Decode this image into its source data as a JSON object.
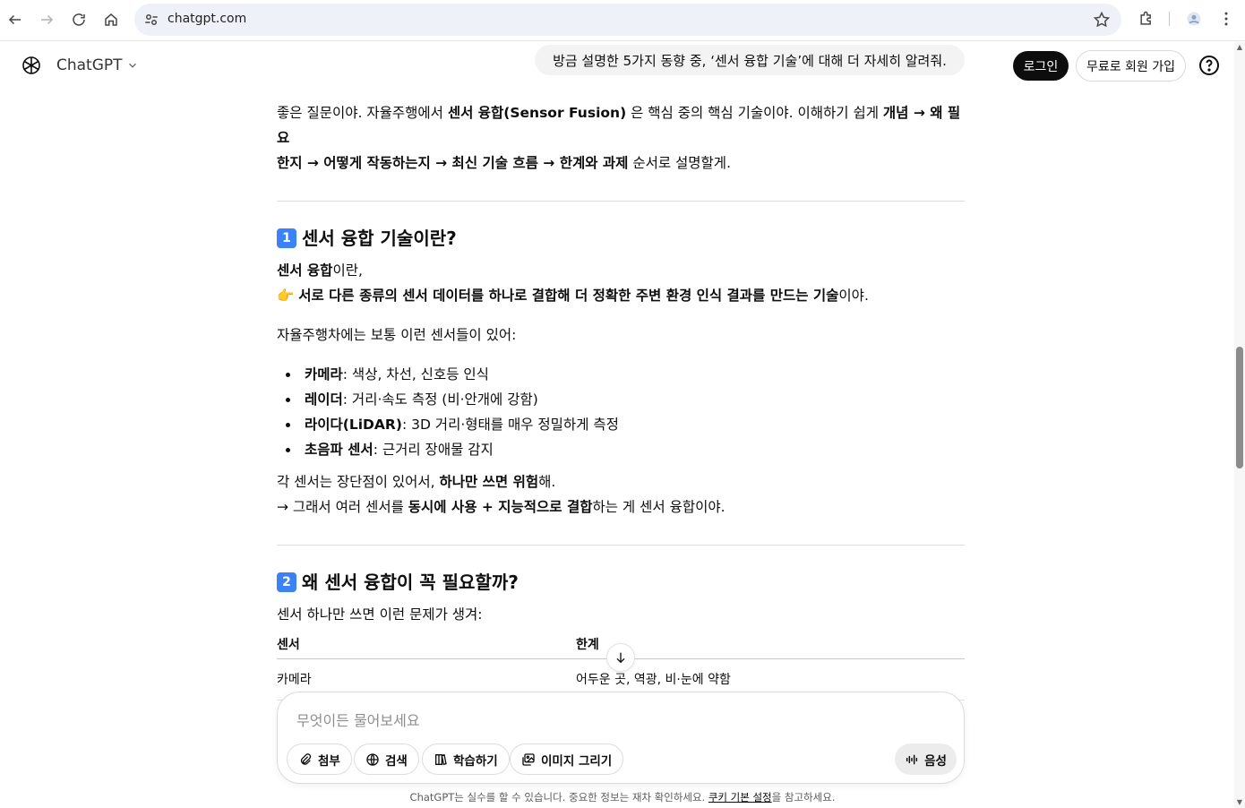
{
  "browser": {
    "url": "chatgpt.com"
  },
  "header": {
    "model_name": "ChatGPT",
    "user_message": "방금 설명한 5가지 동향 중, ‘센서 융합 기술’에 대해 더 자세히 알려줘.",
    "login_label": "로그인",
    "signup_label": "무료로 회원 가입"
  },
  "content": {
    "intro": {
      "t1": "좋은 질문이야. 자율주행에서 ",
      "b1": "센서 융합(Sensor Fusion)",
      "t2": " 은 핵심 중의 핵심 기술이야. 이해하기 쉽게 ",
      "b2": "개념 → 왜 필요",
      "b3": "한지 → 어떻게 작동하는지 → 최신 기술 흐름 → 한계와 과제",
      "t3": " 순서로 설명할게."
    },
    "section1": {
      "badge": "1",
      "title": "센서 융합 기술이란?",
      "def_bold": "센서 융합",
      "def_rest": "이란,",
      "point_emoji": "👉",
      "point_bold": "서로 다른 종류의 센서 데이터를 하나로 결합해 더 정확한 주변 환경 인식 결과를 만드는 기술",
      "point_rest": "이야.",
      "sensors_intro": "자율주행차에는 보통 이런 센서들이 있어:",
      "sensors": [
        {
          "name": "카메라",
          "desc": ": 색상, 차선, 신호등 인식"
        },
        {
          "name": "레이더",
          "desc": ": 거리·속도 측정 (비·안개에 강함)"
        },
        {
          "name": "라이다(LiDAR)",
          "desc": ": 3D 거리·형태를 매우 정밀하게 측정"
        },
        {
          "name": "초음파 센서",
          "desc": ": 근거리 장애물 감지"
        }
      ],
      "note1_plain": "각 센서는 장단점이 있어서, ",
      "note1_bold": "하나만 쓰면 위험",
      "note1_end": "해.",
      "note2_plain": "→ 그래서 여러 센서를 ",
      "note2_bold": "동시에 사용 + 지능적으로 결합",
      "note2_end": "하는 게 센서 융합이야."
    },
    "section2": {
      "badge": "2",
      "title": "왜 센서 융합이 꼭 필요할까?",
      "intro": "센서 하나만 쓰면 이런 문제가 생겨:",
      "table": {
        "headers": [
          "센서",
          "한계"
        ],
        "rows": [
          [
            "카메라",
            "어두운 곳, 역광, 비·눈에 약함"
          ]
        ]
      }
    }
  },
  "composer": {
    "placeholder": "무엇이든 물어보세요",
    "tools": {
      "attach": "첨부",
      "search": "검색",
      "study": "학습하기",
      "image": "이미지 그리기"
    },
    "voice": "음성"
  },
  "footer": {
    "text1": "ChatGPT는 실수를 할 수 있습니다. 중요한 정보는 재차 확인하세요. ",
    "link": "쿠키 기본 설정",
    "text2": "을 참고하세요."
  }
}
